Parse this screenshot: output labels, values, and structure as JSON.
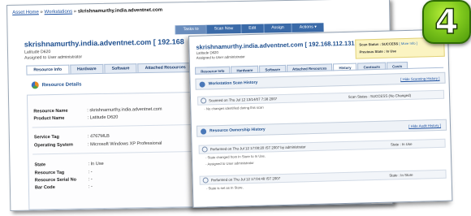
{
  "badge_number": "4",
  "back_window": {
    "breadcrumb": {
      "asset_home": "Asset Home",
      "workstations": "Workstations",
      "current": "skrishnamurthy.india.adventnet.com"
    },
    "toolbar": [
      "Tasks to",
      "Scan Now",
      "Edit",
      "Assign",
      "Actions ▾"
    ],
    "title": "skrishnamurthy.india.adventnet.com [ 192.168",
    "model": "Latitude D620",
    "assigned": "Assigned to User administrator",
    "tabs": [
      "Resource Info",
      "Hardware",
      "Software",
      "Attached Resources"
    ],
    "section_title": "Resource Details",
    "details": [
      {
        "label": "Resource Name",
        "value": ": skrishnamurthy.india.adventnet.com"
      },
      {
        "label": "Product Name",
        "value": ": Latitude D620"
      },
      {
        "label": "Service Tag",
        "value": ": 4767MLB"
      },
      {
        "label": "Operating System",
        "value": ": Microsoft Windows XP Professional"
      },
      {
        "label": "State",
        "value": ": In Use"
      },
      {
        "label": "Resource Tag",
        "value": ": -"
      },
      {
        "label": "Resource Serial No",
        "value": ": -"
      },
      {
        "label": "Bar Code",
        "value": ": -"
      }
    ]
  },
  "front_window": {
    "title": "skrishnamurthy.india.adventnet.com [ 192.168.112.131 ]",
    "model": "Latitude D620",
    "assigned": "Assigned to User administrator",
    "status": {
      "scan_status_label": "Scan Status",
      "scan_status_value": ": SUCCESS",
      "scan_link": "[ More Info ]",
      "previous_state_label": "Previous State",
      "previous_state_value": ": In Use"
    },
    "tabs": [
      "Resource Info",
      "Hardware",
      "Software",
      "Attached Resources",
      "History",
      "Contracts",
      "Costs"
    ],
    "scan_history": {
      "title": "Workstation Scan History",
      "link": "[ Hide Scanning History ]",
      "entry_date": "Scanned on Thu Jul 12 13/14/07 7:38 2007",
      "entry_status": "Scan Status : SUCCESS (No Changed)",
      "entry_note": "- No changes identified during this scan"
    },
    "ownership_history": {
      "title": "Resource Ownership History",
      "link": "[ Hide Audit History ]",
      "entries": [
        {
          "header": "Performed on Thu Jul 12 17:00:20 IST 2007 by administrator",
          "state": "State : In Use",
          "lines": [
            "- State changed from In Store to In Use.",
            "- Assigned to User administrator"
          ]
        },
        {
          "header": "Performed on Thu Jul 12 17:04:48 IST 2007",
          "state": "State : In Store",
          "lines": [
            "- State is set as In Store."
          ]
        }
      ]
    }
  }
}
